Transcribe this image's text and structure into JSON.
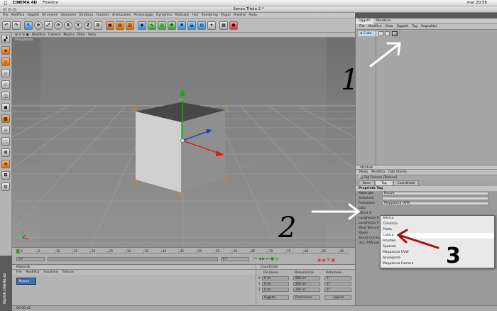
{
  "mac_menu": {
    "app": "CINEMA 4D",
    "items": [
      "Finestra"
    ],
    "clock": "mar 20:56"
  },
  "window": {
    "title": "Senza Titolo 2 *"
  },
  "main_menu": [
    "File",
    "Modifica",
    "Oggetti",
    "Strumenti",
    "Selezione",
    "Struttura",
    "Funzioni",
    "Animazione",
    "Personaggio",
    "Dynamics",
    "MoGraph",
    "Hair",
    "Rendering",
    "Plugin",
    "Finestre",
    "Aiuto"
  ],
  "toolbar": {
    "axis_buttons": [
      "X",
      "Y",
      "Z"
    ]
  },
  "viewport": {
    "menu": [
      "Modifica",
      "Camera",
      "Mostra",
      "Filtro",
      "Vista"
    ],
    "label": "Prospettiva"
  },
  "timeline": {
    "ticks": [
      "0",
      "5",
      "10",
      "15",
      "20",
      "25",
      "30",
      "35",
      "40",
      "45",
      "50",
      "55",
      "60",
      "65",
      "70",
      "75",
      "80",
      "85",
      "90"
    ],
    "start_field": "0 F",
    "end_field": "0 F"
  },
  "materials": {
    "title": "Materiali",
    "menu": [
      "File",
      "Modifica",
      "Funzione",
      "Texture"
    ],
    "item": "Nuovo"
  },
  "coordinates": {
    "title": "Coordinate",
    "headers": [
      "Posizione",
      "Dimensione",
      "Rotazione"
    ],
    "axes": [
      "X",
      "Y",
      "Z"
    ],
    "position": [
      "0 cm",
      "0 cm",
      "0 cm"
    ],
    "size": [
      "200 cm",
      "200 cm",
      "200 cm"
    ],
    "rotation": [
      "0 °",
      "0 °",
      "0 °"
    ],
    "mode_left": "Oggetto",
    "mode_right": "Dimensione",
    "apply": "Applica"
  },
  "status": "00:00:45",
  "objects_panel": {
    "tabs": [
      "Oggetti",
      "Struttura"
    ],
    "menu": [
      "File",
      "Modifica",
      "Vista",
      "Oggetti",
      "Tag",
      "Segnalibri"
    ],
    "object": "Cubo"
  },
  "attributes": {
    "title": "Attributi",
    "menu": [
      "Modo",
      "Modifica",
      "Dati Utente"
    ],
    "tag_title": "Tag Texture [Texture]",
    "tabs": [
      "Base",
      "Tag",
      "Coordinate"
    ],
    "section": "Proprietà Tag",
    "rows": [
      {
        "label": "Materiale",
        "value": "Nuovo"
      },
      {
        "label": "Selezione",
        "value": ""
      },
      {
        "label": "Proiezione",
        "value": "Mappatura UVW"
      },
      {
        "label": "Lato",
        "value": ""
      },
      {
        "label": "Offset X",
        "value": ""
      },
      {
        "label": "Lunghezza X",
        "value": ""
      },
      {
        "label": "Lunghezza Y",
        "value": ""
      },
      {
        "label": "Mixa Texture",
        "value": ""
      },
      {
        "label": "Ripeti",
        "value": ""
      },
      {
        "label": "Senza Cuciture",
        "value": ""
      },
      {
        "label": "Usa UVW per",
        "value": ""
      }
    ]
  },
  "projection_dropdown": {
    "options": [
      "Sferica",
      "Cilindrica",
      "Piatta",
      "Cubica",
      "Frontale",
      "Spaziale",
      "Mappatura UVW",
      "Avvolgente",
      "Mappatura Camera"
    ],
    "highlighted": "Cubica"
  },
  "annotations": {
    "one": "1",
    "two": "2",
    "three": "3"
  },
  "maxon_logo": "MAXON CINEMA 4D",
  "colors": {
    "accent_orange": "#e08a2a",
    "annotation_red": "#a81010",
    "annotation_white": "#ffffff",
    "annotation_black": "#000000"
  }
}
